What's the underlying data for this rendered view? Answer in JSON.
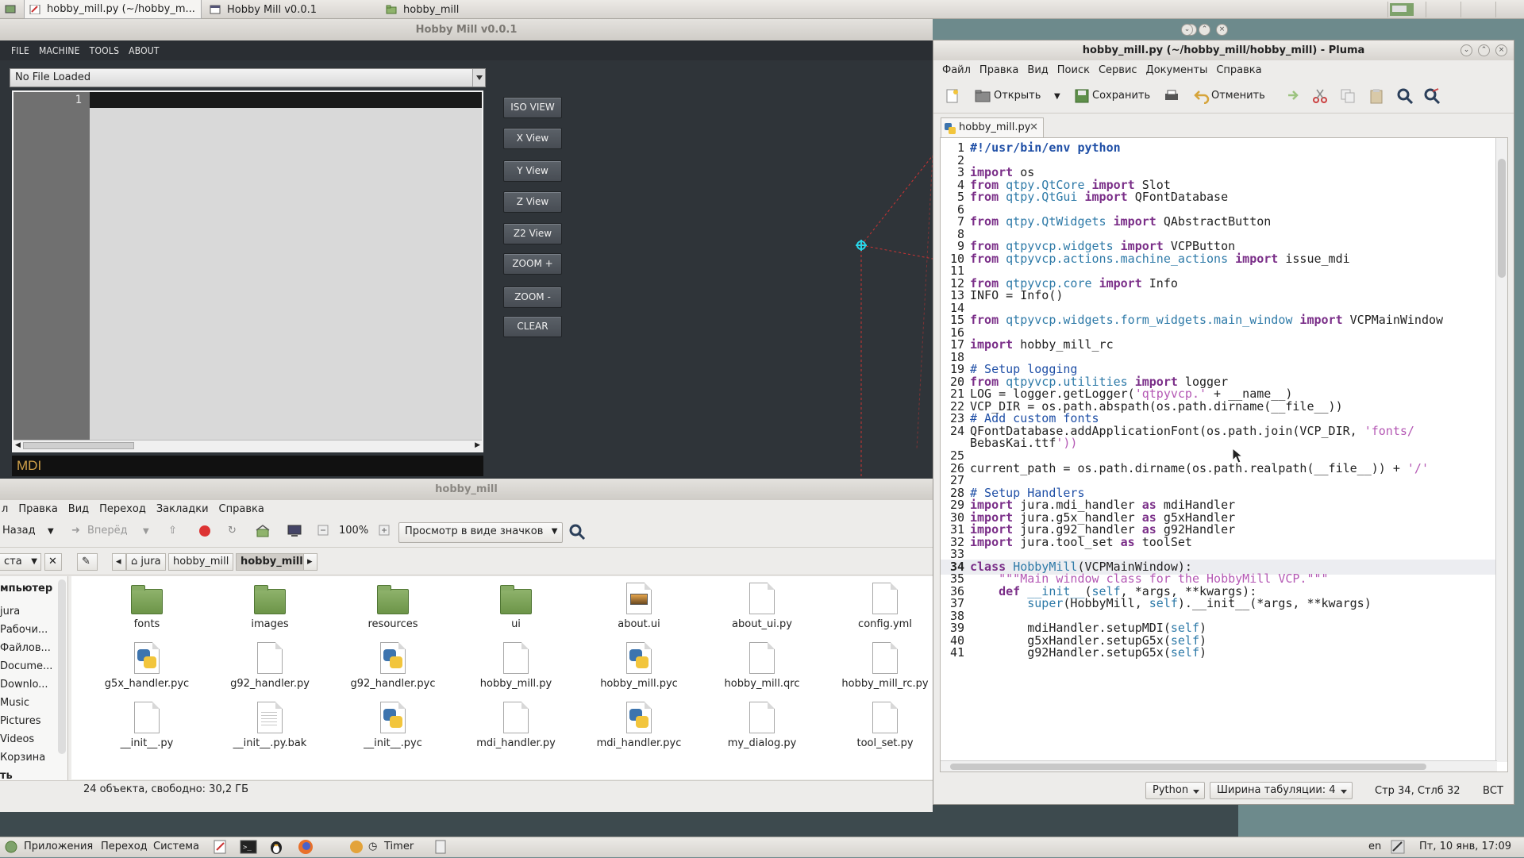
{
  "top_panel": {
    "tasks": [
      {
        "label": "hobby_mill.py (~/hobby_m..."
      },
      {
        "label": "Hobby Mill v0.0.1"
      },
      {
        "label": "hobby_mill"
      }
    ]
  },
  "hobby_mill": {
    "title": "Hobby Mill v0.0.1",
    "menu": [
      "FILE",
      "MACHINE",
      "TOOLS",
      "ABOUT"
    ],
    "file_combo": "No File Loaded",
    "editor_line": "1",
    "mdi_placeholder": "MDI",
    "view_buttons": [
      "ISO VIEW",
      "X View",
      "Y View",
      "Z View",
      "Z2 View",
      "ZOOM +",
      "ZOOM -",
      "CLEAR"
    ]
  },
  "file_manager": {
    "title": "hobby_mill",
    "menu": [
      "л",
      "Правка",
      "Вид",
      "Переход",
      "Закладки",
      "Справка"
    ],
    "toolbar": {
      "back": "Назад",
      "forward": "Вперёд",
      "zoom": "100%",
      "view_mode": "Просмотр в виде значков"
    },
    "location_combo": "ста",
    "breadcrumbs": [
      "jura",
      "hobby_mill",
      "hobby_mill"
    ],
    "sidebar": {
      "header": "мпьютер",
      "items": [
        "jura",
        "Рабочи...",
        "Файлов...",
        "Docume...",
        "Downlo...",
        "Music",
        "Pictures",
        "Videos",
        "Корзина",
        "ть"
      ]
    },
    "files": [
      {
        "name": "fonts",
        "type": "folder"
      },
      {
        "name": "images",
        "type": "folder"
      },
      {
        "name": "resources",
        "type": "folder"
      },
      {
        "name": "ui",
        "type": "folder"
      },
      {
        "name": "about.ui",
        "type": "image"
      },
      {
        "name": "about_ui.py",
        "type": "doc"
      },
      {
        "name": "config.yml",
        "type": "doc"
      },
      {
        "name": "g5x_handler.pyc",
        "type": "py"
      },
      {
        "name": "g92_handler.py",
        "type": "doc"
      },
      {
        "name": "g92_handler.pyc",
        "type": "py"
      },
      {
        "name": "hobby_mill.py",
        "type": "doc"
      },
      {
        "name": "hobby_mill.pyc",
        "type": "py"
      },
      {
        "name": "hobby_mill.qrc",
        "type": "doc"
      },
      {
        "name": "hobby_mill_rc.py",
        "type": "doc"
      },
      {
        "name": "__init__.py",
        "type": "doc"
      },
      {
        "name": "__init__.py.bak",
        "type": "text"
      },
      {
        "name": "__init__.pyc",
        "type": "py"
      },
      {
        "name": "mdi_handler.py",
        "type": "doc"
      },
      {
        "name": "mdi_handler.pyc",
        "type": "py"
      },
      {
        "name": "my_dialog.py",
        "type": "doc"
      },
      {
        "name": "tool_set.py",
        "type": "doc"
      }
    ],
    "status": "24 объекта, свободно: 30,2 ГБ"
  },
  "pluma": {
    "title": "hobby_mill.py (~/hobby_mill/hobby_mill) - Pluma",
    "menu": [
      "Файл",
      "Правка",
      "Вид",
      "Поиск",
      "Сервис",
      "Документы",
      "Справка"
    ],
    "toolbar": {
      "open": "Открыть",
      "save": "Сохранить",
      "undo": "Отменить"
    },
    "tab": "hobby_mill.py",
    "code": [
      "#!/usr/bin/env python",
      "",
      "import os",
      "from qtpy.QtCore import Slot",
      "from qtpy.QtGui import QFontDatabase",
      "",
      "from qtpy.QtWidgets import QAbstractButton",
      "",
      "from qtpyvcp.widgets import VCPButton",
      "from qtpyvcp.actions.machine_actions import issue_mdi",
      "",
      "from qtpyvcp.core import Info",
      "INFO = Info()",
      "",
      "from qtpyvcp.widgets.form_widgets.main_window import VCPMainWindow",
      "",
      "import hobby_mill_rc",
      "",
      "# Setup logging",
      "from qtpyvcp.utilities import logger",
      "LOG = logger.getLogger('qtpyvcp.' + __name__)",
      "VCP_DIR = os.path.abspath(os.path.dirname(__file__))",
      "# Add custom fonts",
      "QFontDatabase.addApplicationFont(os.path.join(VCP_DIR, 'fonts/",
      "BebasKai.ttf'))",
      "",
      "current_path = os.path.dirname(os.path.realpath(__file__)) + '/'",
      "",
      "# Setup Handlers",
      "import jura.mdi_handler as mdiHandler",
      "import jura.g5x_handler as g5xHandler",
      "import jura.g92_handler as g92Handler",
      "import jura.tool_set as toolSet",
      "",
      "class HobbyMill(VCPMainWindow):",
      "    \"\"\"Main window class for the HobbyMill VCP.\"\"\"",
      "    def __init__(self, *args, **kwargs):",
      "        super(HobbyMill, self).__init__(*args, **kwargs)",
      "",
      "        mdiHandler.setupMDI(self)",
      "        g5xHandler.setupG5x(self)",
      "        g92Handler.setupG5x(self)"
    ],
    "line_numbers": [
      "1",
      "2",
      "3",
      "4",
      "5",
      "6",
      "7",
      "8",
      "9",
      "10",
      "11",
      "12",
      "13",
      "14",
      "15",
      "16",
      "17",
      "18",
      "19",
      "20",
      "21",
      "22",
      "23",
      "24",
      "",
      "25",
      "26",
      "27",
      "28",
      "29",
      "30",
      "31",
      "32",
      "33",
      "34",
      "35",
      "36",
      "37",
      "38",
      "39",
      "40",
      "41"
    ],
    "status": {
      "language": "Python",
      "tab_width": "Ширина табуляции: 4",
      "position": "Стр 34, Стлб 32",
      "mode": "ВСТ"
    }
  },
  "bottom_panel": {
    "apps": "Приложения",
    "places": "Переход",
    "system": "Система",
    "timer": "Timer",
    "lang": "en",
    "clock": "Пт, 10 янв, 17:09"
  }
}
